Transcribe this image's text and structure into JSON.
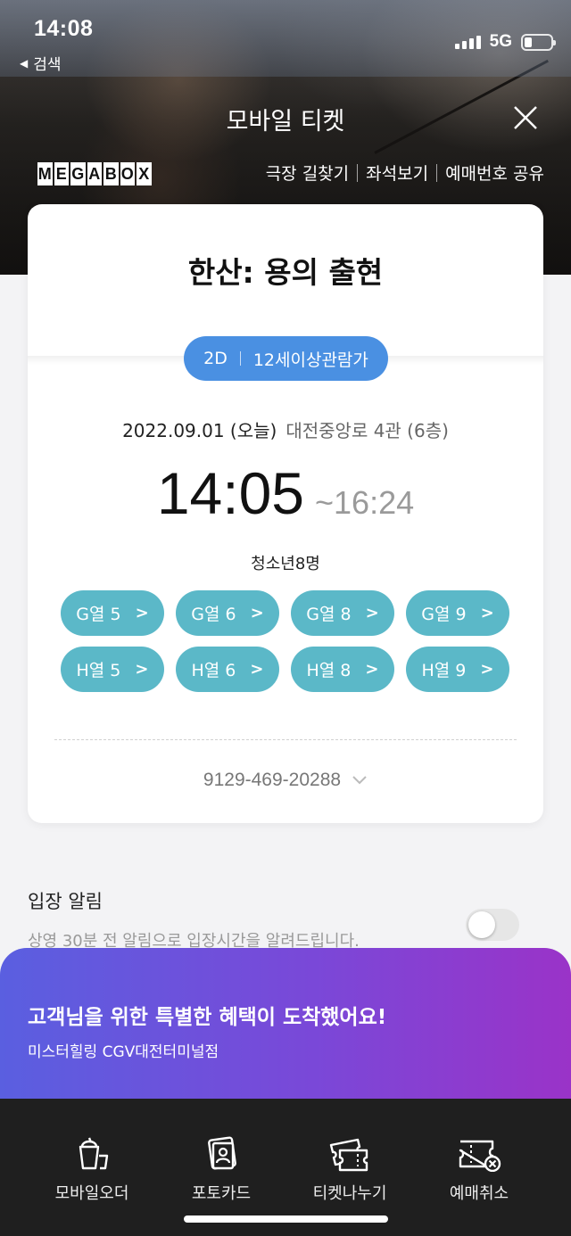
{
  "status_bar": {
    "time": "14:08",
    "back_label": "검색",
    "network": "5G"
  },
  "header": {
    "title": "모바일 티켓",
    "logo": [
      "M",
      "E",
      "G",
      "A",
      "B",
      "O",
      "X"
    ],
    "links": [
      "극장 길찾기",
      "좌석보기",
      "예매번호 공유"
    ]
  },
  "ticket": {
    "movie_title": "한산: 용의 출현",
    "format": "2D",
    "rating": "12세이상관람가",
    "date": "2022.09.01 (오늘)",
    "theater": "대전중앙로 4관 (6층)",
    "start_time": "14:05",
    "end_time": "~16:24",
    "audience": "청소년8명",
    "seats": [
      "G열 5",
      "G열 6",
      "G열 8",
      "G열 9",
      "H열 5",
      "H열 6",
      "H열 8",
      "H열 9"
    ],
    "booking_number": "9129-469-20288"
  },
  "entry_alert": {
    "title": "입장 알림",
    "description": "상영 30분 전 알림으로 입장시간을 알려드립니다.",
    "enabled": false
  },
  "promo": {
    "title": "고객님을 위한 특별한 혜택이 도착했어요!",
    "subtitle": "미스터힐링 CGV대전터미널점"
  },
  "bottom_tabs": [
    {
      "label": "모바일오더",
      "icon": "drink-icon"
    },
    {
      "label": "포토카드",
      "icon": "photo-card-icon"
    },
    {
      "label": "티켓나누기",
      "icon": "ticket-share-icon"
    },
    {
      "label": "예매취소",
      "icon": "ticket-cancel-icon"
    }
  ],
  "colors": {
    "pill_blue": "#4a90e2",
    "seat_teal": "#5bb8c8",
    "promo_start": "#5a5fe0",
    "promo_end": "#9a33c8",
    "bottom_bar": "#1f1f1f"
  }
}
